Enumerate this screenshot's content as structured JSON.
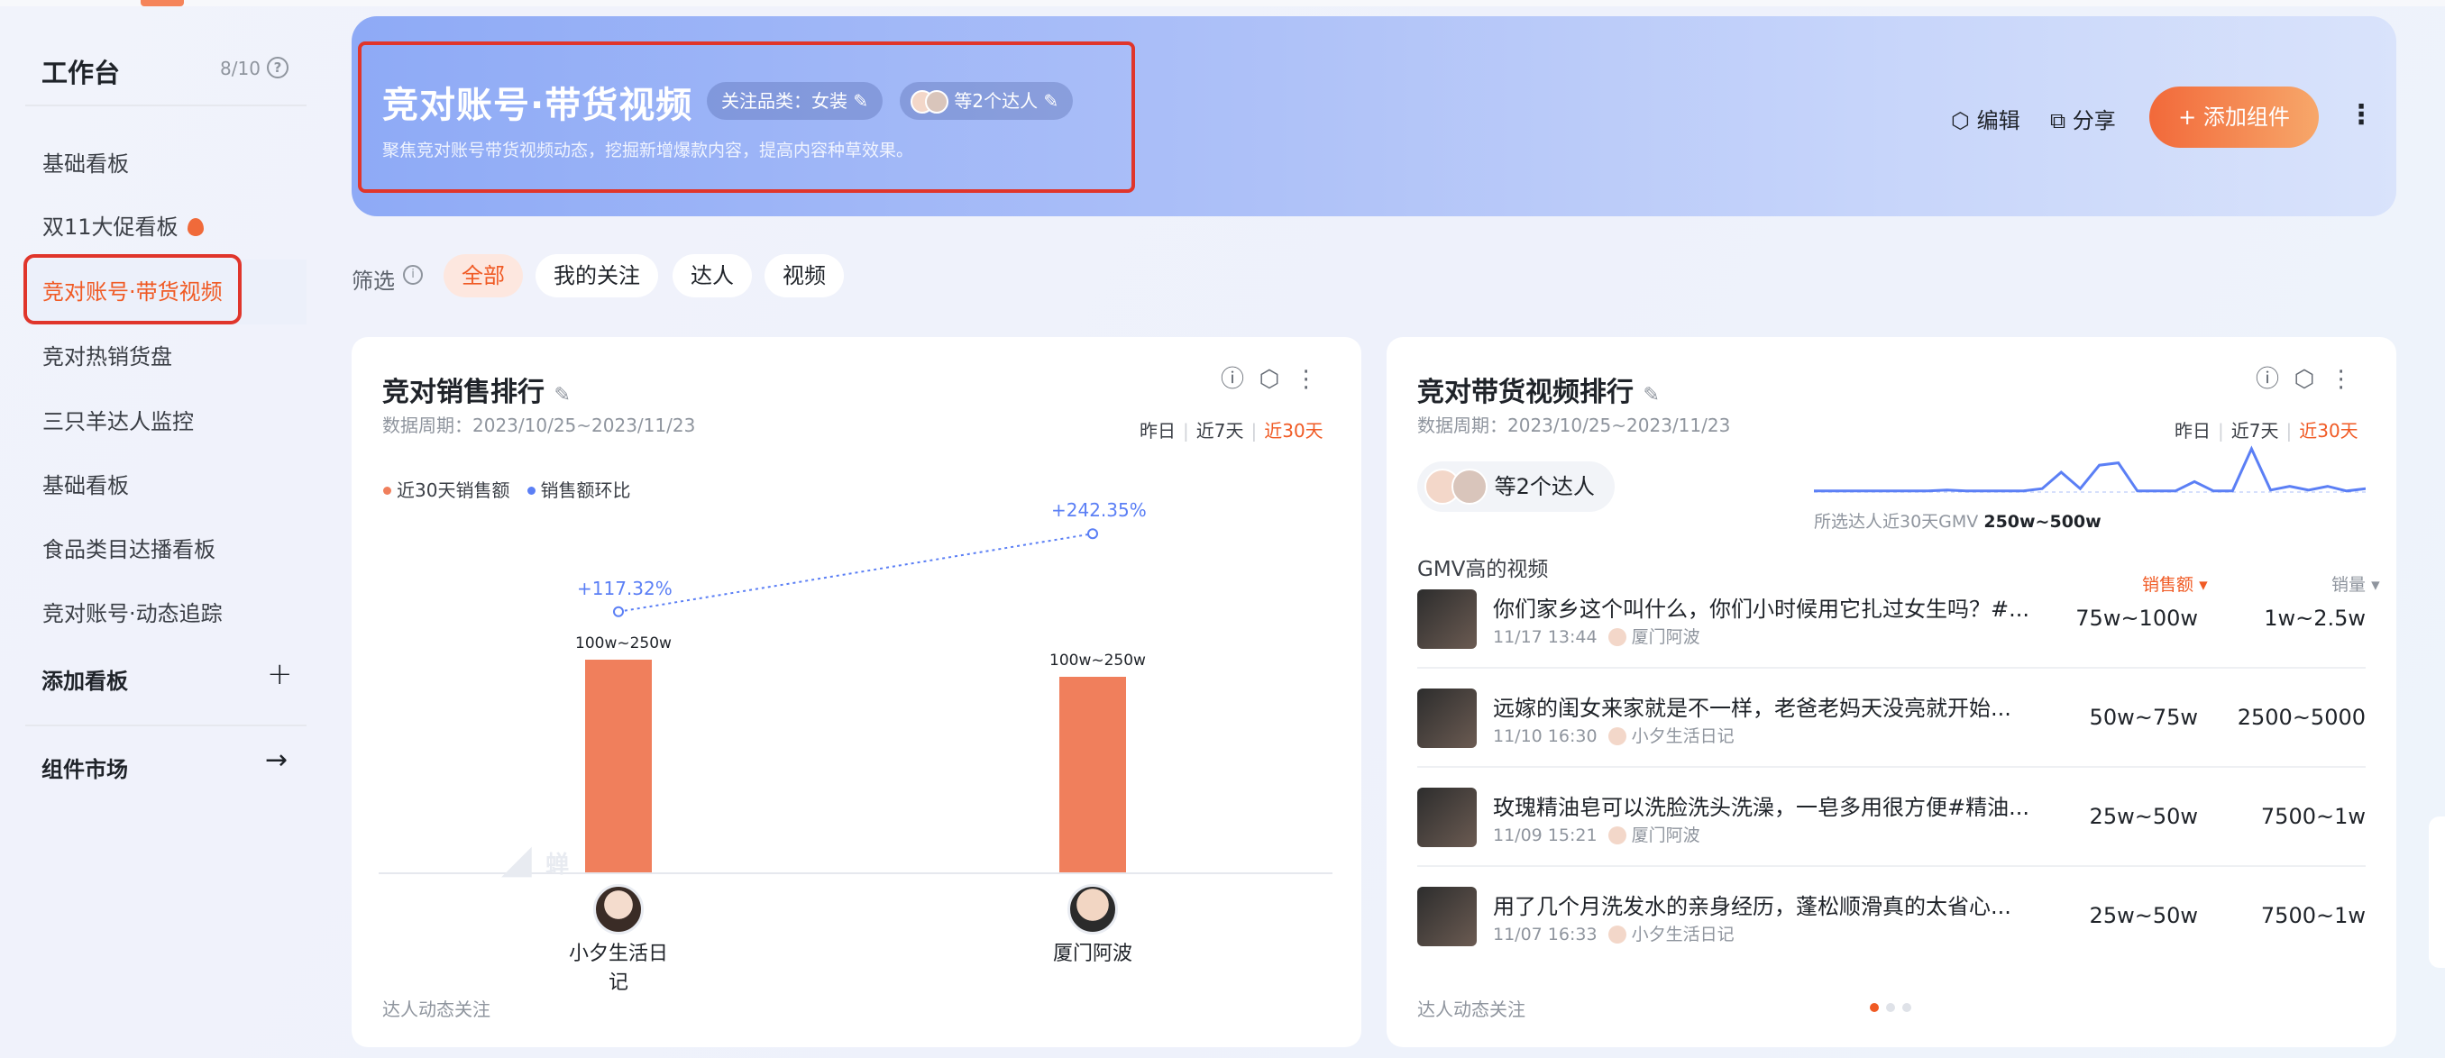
{
  "sidebar": {
    "title": "工作台",
    "count": "8/10",
    "help_icon": "question-circle-icon",
    "items": [
      {
        "label": "基础看板",
        "active": false
      },
      {
        "label": "双11大促看板",
        "active": false,
        "badge_icon": "fire-icon"
      },
      {
        "label": "竞对账号·带货视频",
        "active": true
      },
      {
        "label": "竞对热销货盘",
        "active": false
      },
      {
        "label": "三只羊达人监控",
        "active": false
      },
      {
        "label": "基础看板",
        "active": false
      },
      {
        "label": "食品类目达播看板",
        "active": false
      },
      {
        "label": "竞对账号·动态追踪",
        "active": false
      }
    ],
    "add_board": "添加看板",
    "add_icon": "plus-icon",
    "market": "组件市场",
    "market_icon": "arrow-right-icon"
  },
  "header": {
    "title": "竞对账号·带货视频",
    "category_chip": "关注品类：女装",
    "influencer_chip": "等2个达人",
    "description": "聚焦竞对账号带货视频动态，挖掘新增爆款内容，提高内容种草效果。",
    "edit": "编辑",
    "share": "分享",
    "add_component": "添加组件",
    "edit_icon": "settings-hex-icon",
    "share_icon": "share-icon",
    "more_icon": "more-vertical-icon"
  },
  "filter": {
    "label": "筛选",
    "chips": [
      "全部",
      "我的关注",
      "达人",
      "视频"
    ],
    "selected": "全部"
  },
  "sales_card": {
    "title": "竞对销售排行",
    "period": "数据周期：2023/10/25~2023/11/23",
    "ranges": [
      "昨日",
      "近7天",
      "近30天"
    ],
    "active_range": "近30天",
    "footer": "达人动态关注",
    "watermark": "蝉"
  },
  "video_card": {
    "title": "竞对带货视频排行",
    "period": "数据周期：2023/10/25~2023/11/23",
    "ranges": [
      "昨日",
      "近7天",
      "近30天"
    ],
    "active_range": "近30天",
    "influencers_chip": "等2个达人",
    "gmv_caption": "所选达人近30天GMV",
    "gmv_value": "250w~500w",
    "section_title": "GMV高的视频",
    "col_sales": "销售额",
    "col_volume": "销量",
    "footer": "达人动态关注",
    "page_dots": 3,
    "active_dot": 1,
    "sparkline": [
      0.1,
      0.1,
      0.1,
      0.1,
      0.1,
      0.1,
      0.1,
      0.12,
      0.1,
      0.1,
      0.1,
      0.1,
      0.15,
      0.5,
      0.15,
      0.65,
      0.7,
      0.1,
      0.1,
      0.1,
      0.3,
      0.1,
      0.1,
      1.0,
      0.12,
      0.2,
      0.12,
      0.2,
      0.1,
      0.15
    ],
    "videos": [
      {
        "title": "你们家乡这个叫什么，你们小时候用它扎过女生吗？#...",
        "time": "11/17 13:44",
        "author": "厦门阿波",
        "sales": "75w~100w",
        "volume": "1w~2.5w"
      },
      {
        "title": "远嫁的闺女来家就是不一样，老爸老妈天没亮就开始...",
        "time": "11/10 16:30",
        "author": "小夕生活日记",
        "sales": "50w~75w",
        "volume": "2500~5000"
      },
      {
        "title": "玫瑰精油皂可以洗脸洗头洗澡，一皂多用很方便#精油...",
        "time": "11/09 15:21",
        "author": "厦门阿波",
        "sales": "25w~50w",
        "volume": "7500~1w"
      },
      {
        "title": "用了几个月洗发水的亲身经历，蓬松顺滑真的太省心...",
        "time": "11/07 16:33",
        "author": "小夕生活日记",
        "sales": "25w~50w",
        "volume": "7500~1w"
      }
    ]
  },
  "chart_data": {
    "type": "bar",
    "categories": [
      "小夕生活日记",
      "厦门阿波"
    ],
    "series": [
      {
        "name": "近30天销售额",
        "values": [
          "100w~250w",
          "100w~250w"
        ],
        "relative_level": [
          1.0,
          0.92
        ],
        "color": "#f07f5c"
      },
      {
        "name": "销售额环比",
        "values": [
          117.32,
          242.35
        ],
        "labels": [
          "+117.32%",
          "+242.35%"
        ],
        "color": "#5b7ff5"
      }
    ],
    "legend": "top-left"
  },
  "colors": {
    "accent": "#f05a24",
    "bar": "#f07f5c",
    "line": "#5b7ff5",
    "highlight": "#e0352b"
  }
}
